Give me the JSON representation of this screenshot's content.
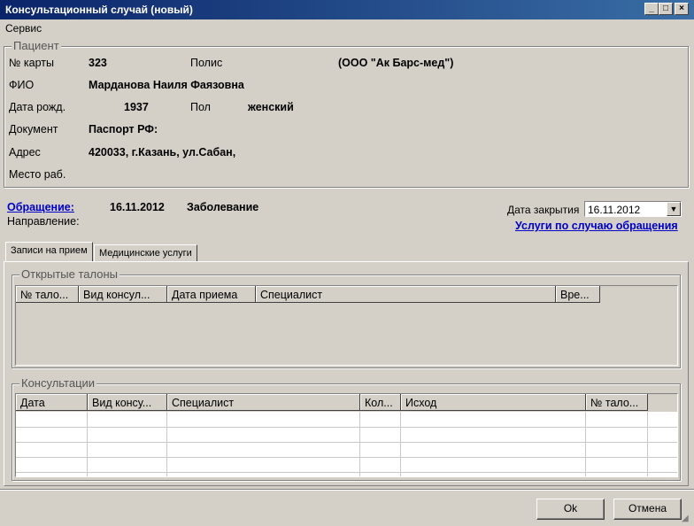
{
  "window": {
    "title": "Консультационный случай (новый)",
    "minimize": "_",
    "maximize": "□",
    "close": "×"
  },
  "menu": {
    "service": "Сервис"
  },
  "patient": {
    "legend": "Пациент",
    "card_label": "№ карты",
    "card_value": "323",
    "policy_label": "Полис",
    "policy_value": "(ООО \"Ак Барс-мед\")",
    "fio_label": "ФИО",
    "fio_value": "Марданова Наиля Фаязовна",
    "dob_label": "Дата рожд.",
    "dob_value": "1937",
    "sex_label": "Пол",
    "sex_value": "женский",
    "doc_label": "Документ",
    "doc_value": "Паспорт РФ:",
    "address_label": "Адрес",
    "address_value": "420033, г.Казань, ул.Сабан,",
    "work_label": "Место раб."
  },
  "appeal": {
    "link": "Обращение:",
    "date": "16.11.2012",
    "type": "Заболевание",
    "direction_label": "Направление:",
    "close_date_label": "Дата закрытия",
    "close_date_value": "16.11.2012",
    "services_link": "Услуги по случаю обращения"
  },
  "tabs": {
    "appointments": "Записи на прием",
    "med_services": "Медицинские услуги"
  },
  "open_tickets": {
    "legend": "Открытые талоны",
    "columns": [
      "№ тало...",
      "Вид консул...",
      "Дата приема",
      "Специалист",
      "Вре..."
    ]
  },
  "consultations": {
    "legend": "Консультации",
    "columns": [
      "Дата",
      "Вид консу...",
      "Специалист",
      "Кол...",
      "Исход",
      "№ тало..."
    ]
  },
  "buttons": {
    "ok": "Ok",
    "cancel": "Отмена"
  },
  "icons": {
    "combo": "chevron-down-icon",
    "grip": "resize-grip-icon"
  }
}
